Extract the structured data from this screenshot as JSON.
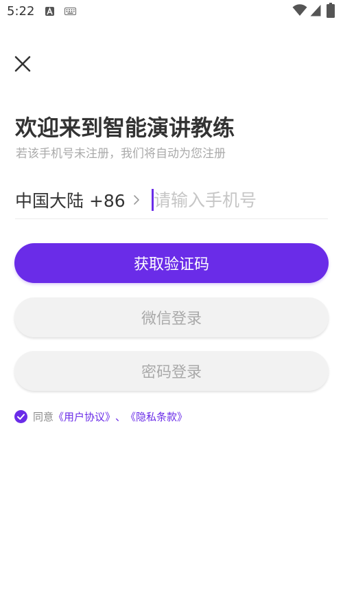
{
  "status_bar": {
    "time": "5:22",
    "icons": [
      "a-notification-icon",
      "keyboard-icon",
      "wifi-icon",
      "signal-icon",
      "battery-icon"
    ]
  },
  "header": {
    "close_icon": "close-icon"
  },
  "main": {
    "title": "欢迎来到智能演讲教练",
    "subtitle": "若该手机号未注册，我们将自动为您注册",
    "region_label": "中国大陆 +86",
    "phone_input": {
      "placeholder": "请输入手机号",
      "value": ""
    },
    "get_code_label": "获取验证码",
    "wechat_login_label": "微信登录",
    "password_login_label": "密码登录"
  },
  "agreement": {
    "checked": true,
    "prefix": "同意",
    "user_agreement": "《用户协议》",
    "separator": "、",
    "privacy_policy": "《隐私条款》"
  },
  "colors": {
    "accent": "#6a2ce8",
    "secondary_button_bg": "#f2f2f2",
    "secondary_button_text": "#a9a9a9",
    "subtitle": "#aaaaaa",
    "title": "#333333"
  }
}
